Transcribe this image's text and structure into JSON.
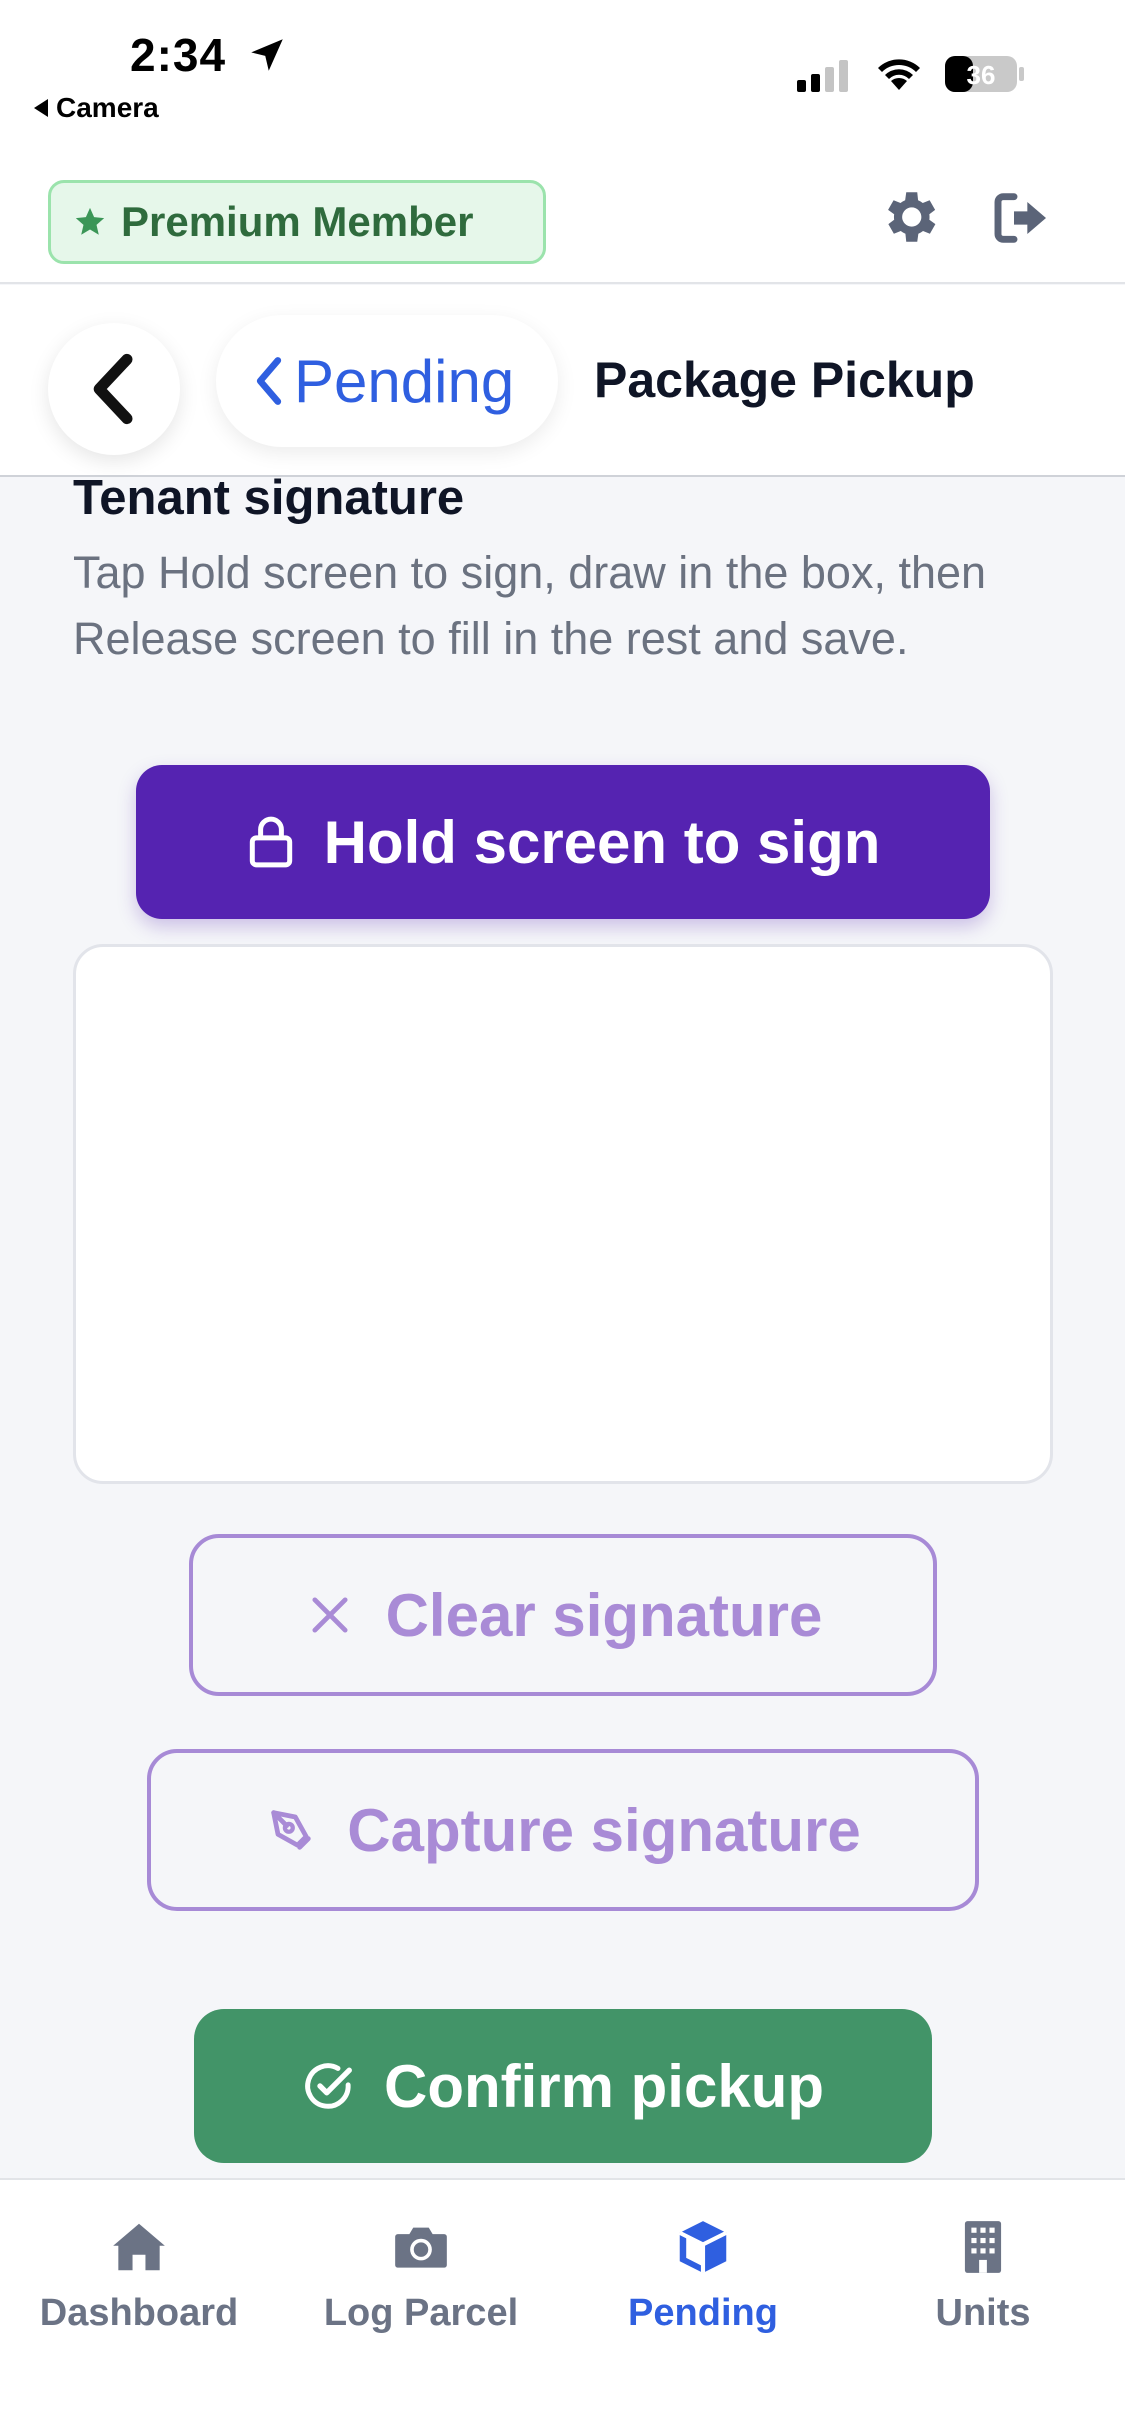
{
  "status_bar": {
    "time": "2:34",
    "back_app_label": "Camera",
    "battery_level": "36"
  },
  "top_bar": {
    "badge_label": "Premium Member",
    "badge_icon": "star-icon",
    "settings_icon": "gear-icon",
    "logout_icon": "logout-icon"
  },
  "nav": {
    "back_icon": "chevron-left-icon",
    "back_label": "Pending",
    "title": "Package Pickup"
  },
  "signature": {
    "heading": "Tenant signature",
    "description": "Tap Hold screen to sign, draw in the box, then Release screen to fill in the rest and save.",
    "hold_button_label": "Hold screen to sign",
    "clear_button_label": "Clear signature",
    "capture_button_label": "Capture signature"
  },
  "actions": {
    "confirm_label": "Confirm pickup"
  },
  "tabs": [
    {
      "label": "Dashboard",
      "icon": "home-icon",
      "active": false
    },
    {
      "label": "Log Parcel",
      "icon": "camera-icon",
      "active": false
    },
    {
      "label": "Pending",
      "icon": "box-icon",
      "active": true
    },
    {
      "label": "Units",
      "icon": "building-icon",
      "active": false
    }
  ],
  "colors": {
    "primary_purple": "#5523b1",
    "outline_purple": "#a98bd6",
    "confirm_green": "#429468",
    "active_blue": "#2f5fe0",
    "badge_green_bg": "#e6f7ea",
    "badge_green_text": "#2f6b3d"
  }
}
